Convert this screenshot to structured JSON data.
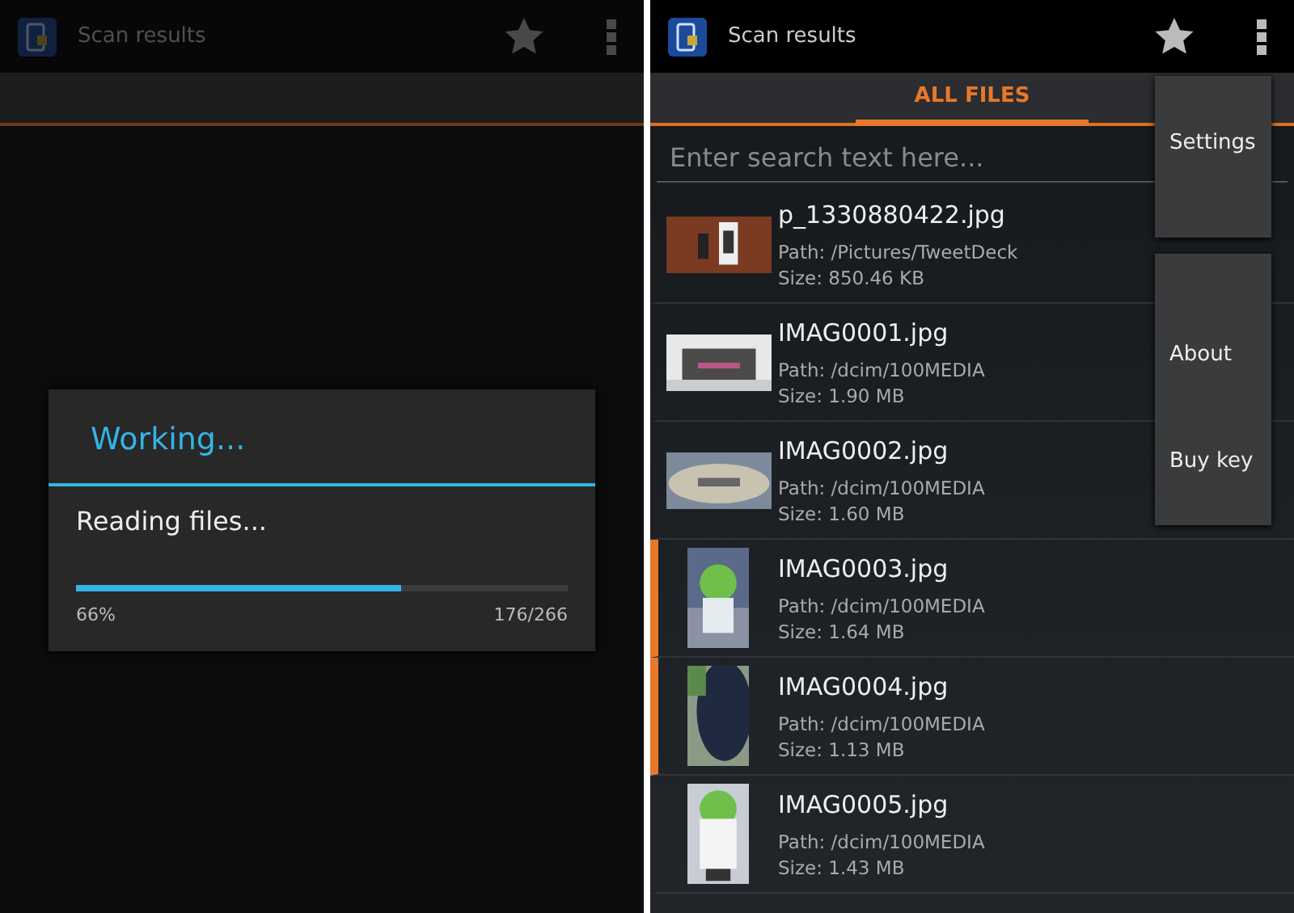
{
  "left_screen": {
    "action_bar": {
      "title": "Scan results"
    },
    "dialog": {
      "title": "Working...",
      "message": "Reading files...",
      "level": 0.66,
      "percent": "66%",
      "count": "176/266"
    }
  },
  "right_screen": {
    "action_bar": {
      "title": "Scan results"
    },
    "tabs": [
      {
        "label": "ALL FILES",
        "selected": true
      }
    ],
    "search": {
      "placeholder": "Enter search text here..."
    },
    "files": [
      {
        "kind": "landscape",
        "name": "p_1330880422.jpg",
        "path": "Path: /Pictures/TweetDeck",
        "size": "Size: 850.46 KB",
        "selected": false
      },
      {
        "kind": "landscape",
        "name": "IMAG0001.jpg",
        "path": "Path: /dcim/100MEDIA",
        "size": "Size: 1.90 MB",
        "selected": false
      },
      {
        "kind": "landscape",
        "name": "IMAG0002.jpg",
        "path": "Path: /dcim/100MEDIA",
        "size": "Size: 1.60 MB",
        "selected": false
      },
      {
        "kind": "portrait",
        "name": "IMAG0003.jpg",
        "path": "Path: /dcim/100MEDIA",
        "size": "Size: 1.64 MB",
        "selected": true
      },
      {
        "kind": "portrait",
        "name": "IMAG0004.jpg",
        "path": "Path: /dcim/100MEDIA",
        "size": "Size: 1.13 MB",
        "selected": true
      },
      {
        "kind": "portrait",
        "name": "IMAG0005.jpg",
        "path": "Path: /dcim/100MEDIA",
        "size": "Size: 1.43 MB",
        "selected": false
      }
    ],
    "menus": [
      {
        "items": [
          "Settings"
        ]
      },
      {
        "items": [
          "About",
          "Buy key"
        ]
      }
    ]
  }
}
